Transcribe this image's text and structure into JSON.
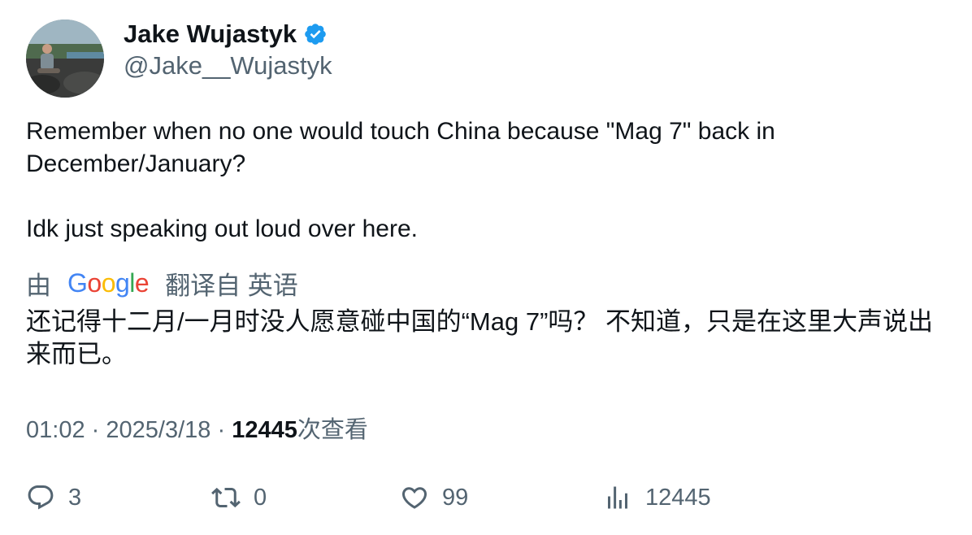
{
  "author": {
    "name": "Jake Wujastyk",
    "handle": "@Jake__Wujastyk",
    "verified_icon": "verified-badge-icon",
    "verified_color": "#1d9bf0"
  },
  "tweet": {
    "paragraphs": [
      "Remember when no one would touch China because \"Mag 7\" back in December/January?",
      "Idk just speaking out loud over here."
    ]
  },
  "translation": {
    "prefix": "由",
    "google_letters": [
      {
        "char": "G",
        "color": "#4285F4"
      },
      {
        "char": "o",
        "color": "#EA4335"
      },
      {
        "char": "o",
        "color": "#FBBC05"
      },
      {
        "char": "g",
        "color": "#4285F4"
      },
      {
        "char": "l",
        "color": "#34A853"
      },
      {
        "char": "e",
        "color": "#EA4335"
      }
    ],
    "suffix": "翻译自 英语",
    "text": "还记得十二月/一月时没人愿意碰中国的“Mag 7”吗？ 不知道，只是在这里大声说出来而已。"
  },
  "meta": {
    "time": "01:02",
    "separator": "·",
    "date": "2025/3/18",
    "views_count": "12445",
    "views_label": "次查看"
  },
  "actions": {
    "reply": {
      "icon": "reply-icon",
      "count": "3"
    },
    "retweet": {
      "icon": "retweet-icon",
      "count": "0"
    },
    "like": {
      "icon": "heart-icon",
      "count": "99"
    },
    "views": {
      "icon": "analytics-icon",
      "count": "12445"
    }
  },
  "colors": {
    "text_primary": "#0f1419",
    "text_secondary": "#536471"
  }
}
